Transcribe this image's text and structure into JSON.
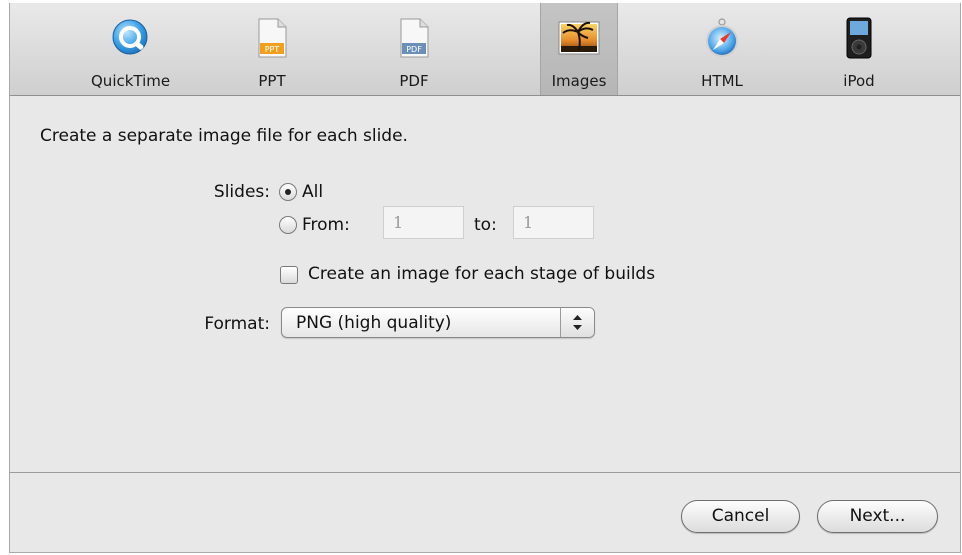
{
  "toolbar": {
    "tabs": [
      {
        "label": "QuickTime",
        "icon": "quicktime-icon"
      },
      {
        "label": "PPT",
        "icon": "ppt-document-icon",
        "badge": "PPT"
      },
      {
        "label": "PDF",
        "icon": "pdf-document-icon",
        "badge": "PDF"
      },
      {
        "label": "Images",
        "icon": "image-palm-icon",
        "selected": true
      },
      {
        "label": "HTML",
        "icon": "safari-compass-icon"
      },
      {
        "label": "iPod",
        "icon": "ipod-icon"
      }
    ]
  },
  "main": {
    "description": "Create a separate image file for each slide.",
    "slides": {
      "label": "Slides:",
      "all_label": "All",
      "all_selected": true,
      "from_label": "From:",
      "from_value": "1",
      "to_label": "to:",
      "to_value": "1"
    },
    "builds": {
      "label": "Create an image for each stage of builds",
      "checked": false
    },
    "format": {
      "label": "Format:",
      "value": "PNG (high quality)"
    }
  },
  "footer": {
    "cancel_label": "Cancel",
    "next_label": "Next..."
  },
  "colors": {
    "window_bg": "#e8e8e8",
    "selected_tab_bg": "#b9b9b9",
    "quicktime_blue": "#3aa0e6",
    "ppt_orange": "#f0a020",
    "pdf_blue": "#6c8fb8"
  }
}
